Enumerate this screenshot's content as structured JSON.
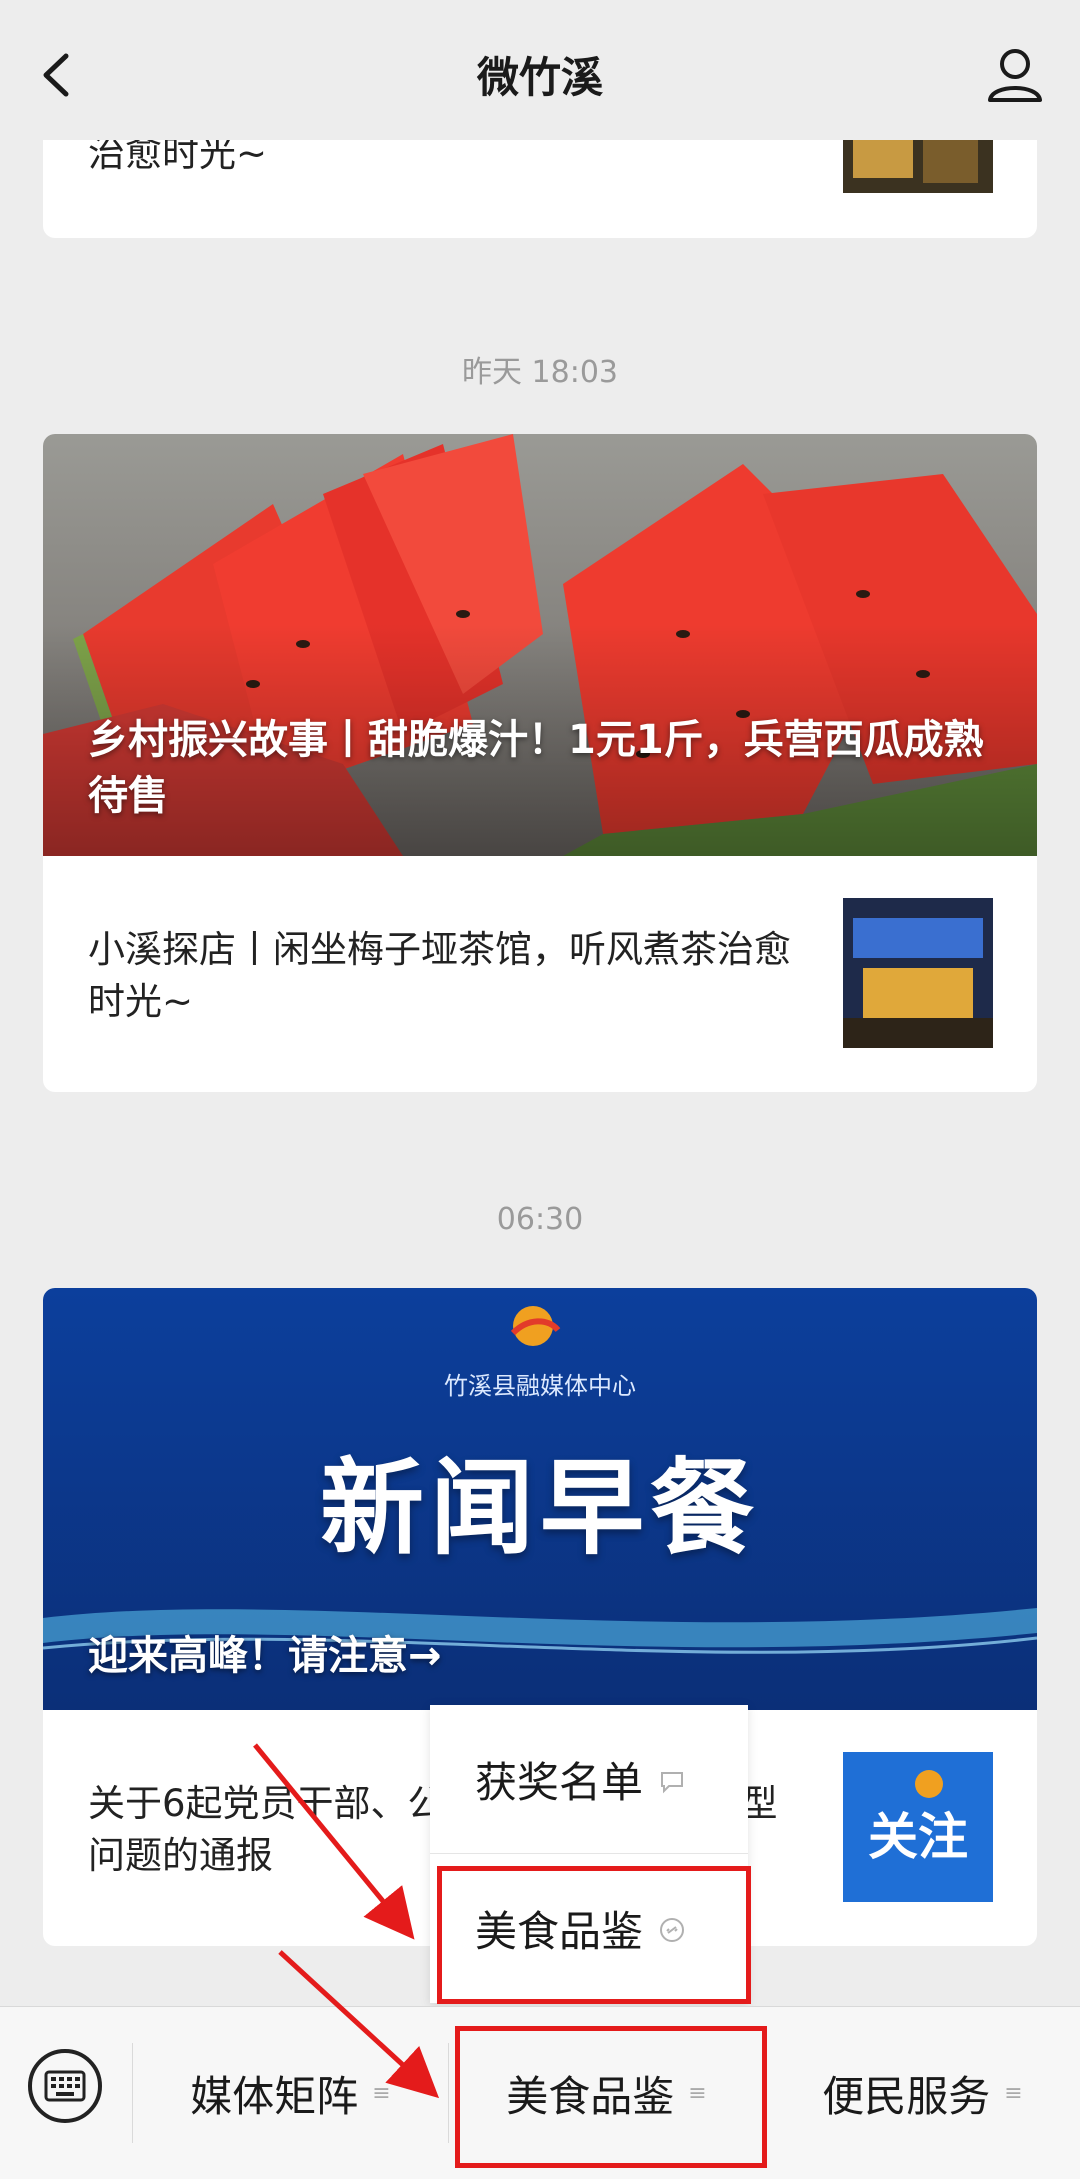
{
  "header": {
    "title": "微竹溪"
  },
  "feed": {
    "top_card_text": "治愈时光~",
    "stamp_1": "昨天 18:03",
    "article_1": {
      "hero_title": "乡村振兴故事丨甜脆爆汁！1元1斤，兵营西瓜成熟待售",
      "sub_title": "小溪探店丨闲坐梅子垭茶馆，听风煮茶治愈时光~"
    },
    "stamp_2": "06:30",
    "article_2": {
      "banner_org": "竹溪县融媒体中心",
      "banner_big": "新闻早餐",
      "hero_title": "迎来高峰！请注意→",
      "sub_title": "关于6起党员干部、公职人员违规违纪典型问题的通报",
      "thumb_text": "关注"
    }
  },
  "popup_menu": {
    "items": [
      "获奖名单",
      "美食品鉴"
    ]
  },
  "bottom_menu": {
    "items": [
      "媒体矩阵",
      "美食品鉴",
      "便民服务"
    ]
  },
  "colors": {
    "annotation_red": "#e41b1b",
    "banner_blue": "#0f4fb0"
  }
}
